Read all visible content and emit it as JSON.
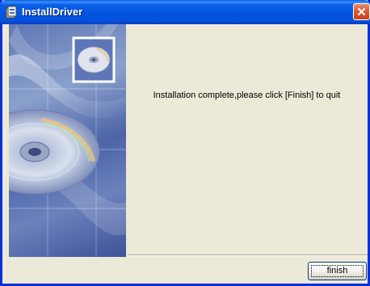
{
  "window": {
    "title": "InstallDriver",
    "icon": "installer-icon",
    "close_icon": "close-icon"
  },
  "main": {
    "message": "Installation complete,please click [Finish] to quit",
    "finish_label": "finish"
  },
  "side_panel": {
    "artwork": [
      "cd-disc-icon",
      "cd-disc-large-illustration"
    ]
  },
  "colors": {
    "title_bar": "#0355e0",
    "window_border": "#0831d9",
    "dialog_bg": "#ece9d8",
    "close_button": "#d9582f"
  }
}
